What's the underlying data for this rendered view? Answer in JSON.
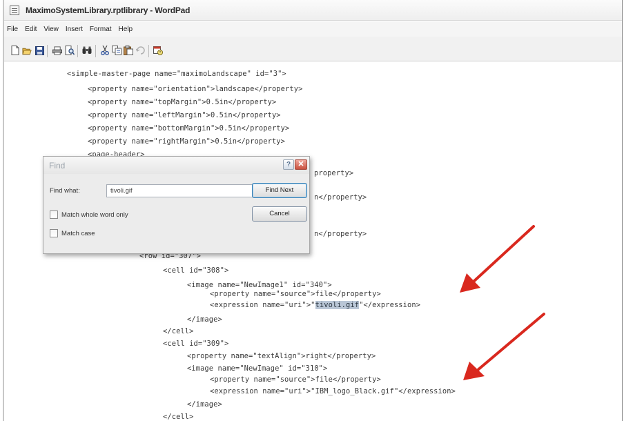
{
  "window": {
    "title": "MaximoSystemLibrary.rptlibrary - WordPad"
  },
  "menu": [
    "File",
    "Edit",
    "View",
    "Insert",
    "Format",
    "Help"
  ],
  "toolbar": {
    "buttons": [
      "new-icon",
      "open-icon",
      "save-icon",
      "print-icon",
      "print-preview-icon",
      "find-icon",
      "cut-icon",
      "copy-icon",
      "paste-icon",
      "undo-icon",
      "date-time-icon"
    ]
  },
  "document": {
    "lines": [
      "<simple-master-page name=\"maximoLandscape\" id=\"3\">",
      "<property name=\"orientation\">landscape</property>",
      "<property name=\"topMargin\">0.5in</property>",
      "<property name=\"leftMargin\">0.5in</property>",
      "<property name=\"bottomMargin\">0.5in</property>",
      "<property name=\"rightMargin\">0.5in</property>",
      "<page-header>",
      "property>",
      "n</property>",
      "n</property>",
      "<row id=\"307\">",
      "<cell id=\"308\">",
      "<image name=\"NewImage1\" id=\"340\">",
      "<property name=\"source\">file</property>",
      "<expression name=\"uri\">\"",
      "tivoli.gif",
      "\"</expression>",
      "</image>",
      "</cell>",
      "<cell id=\"309\">",
      "<property name=\"textAlign\">right</property>",
      "<image name=\"NewImage\" id=\"310\">",
      "<property name=\"source\">file</property>",
      "<expression name=\"uri\">\"IBM_logo_Black.gif\"</expression>",
      "</image>",
      "</cell>"
    ]
  },
  "find_dialog": {
    "title": "Find",
    "help_label": "?",
    "find_what_label": "Find what:",
    "find_what_value": "tivoli.gif",
    "find_next_label": "Find Next",
    "cancel_label": "Cancel",
    "match_whole_word_label": "Match whole word only",
    "match_case_label": "Match case",
    "match_whole_word_checked": false,
    "match_case_checked": false
  },
  "colors": {
    "arrow": "#d9281e",
    "highlight": "#b9c6d6",
    "code_text": "#3a3a3a"
  }
}
